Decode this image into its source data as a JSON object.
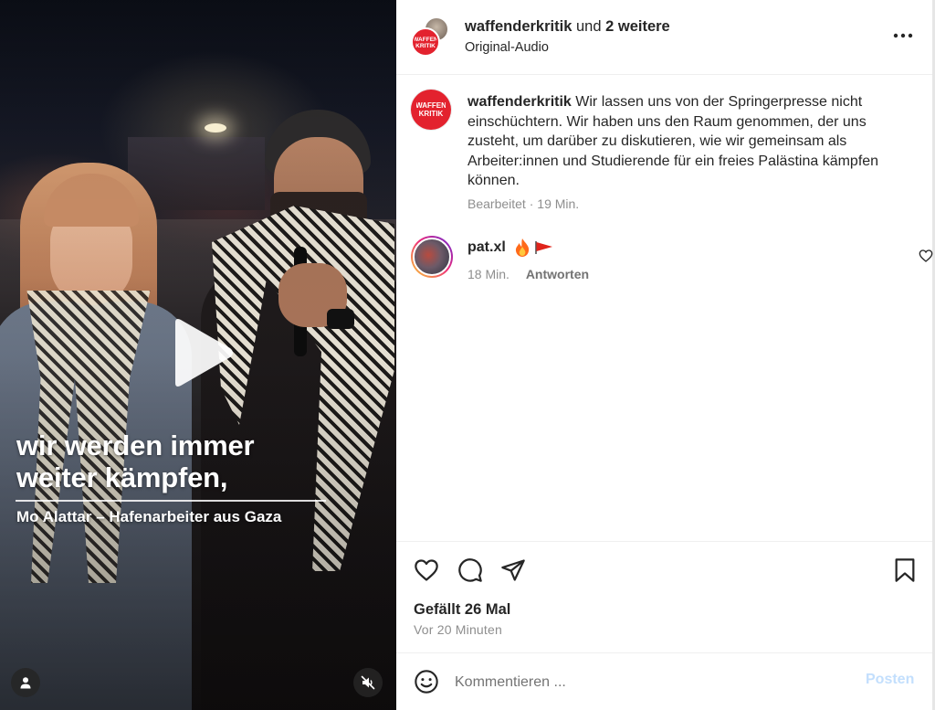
{
  "video": {
    "subtitle_lines": [
      "wir werden immer",
      "weiter kämpfen,"
    ],
    "credit": "Mo Alattar – Hafenarbeiter aus Gaza",
    "icons": {
      "play": "play-icon",
      "tag": "user-tag-icon",
      "mute": "speaker-muted-icon"
    }
  },
  "header": {
    "username": "waffenderkritik",
    "conjunction": "und",
    "others": "2 weitere",
    "audio": "Original-Audio",
    "avatar_logo_lines": [
      "WAFFEN",
      "KRITIK"
    ],
    "icons": {
      "more": "more-options-icon"
    }
  },
  "caption": {
    "username": "waffenderkritik",
    "text": "Wir lassen uns von der Springerpresse nicht einschüchtern. Wir haben uns den Raum genommen, der uns zusteht, um darüber zu diskutieren, wie wir gemeinsam als Arbeiter:innen und Studierende für ein freies Palästina kämpfen können.",
    "edited": "Bearbeitet",
    "separator": "·",
    "time": "19 Min."
  },
  "comment": {
    "username": "pat.xl",
    "emoji_icons": [
      "fire-emoji",
      "red-flag-emoji"
    ],
    "time": "18 Min.",
    "reply_label": "Antworten",
    "icons": {
      "like": "heart-outline-icon"
    }
  },
  "actions": {
    "icons": [
      "heart-icon",
      "comment-icon",
      "share-icon",
      "bookmark-icon"
    ],
    "likes": "Gefällt 26 Mal",
    "posted": "Vor 20 Minuten"
  },
  "composer": {
    "placeholder": "Kommentieren ...",
    "post_label": "Posten",
    "icons": {
      "emoji": "emoji-icon"
    }
  },
  "colors": {
    "brand_red": "#e3222e",
    "post_button_disabled": "#c3dffd",
    "muted_text": "#8e8e8e",
    "text": "#262626"
  }
}
